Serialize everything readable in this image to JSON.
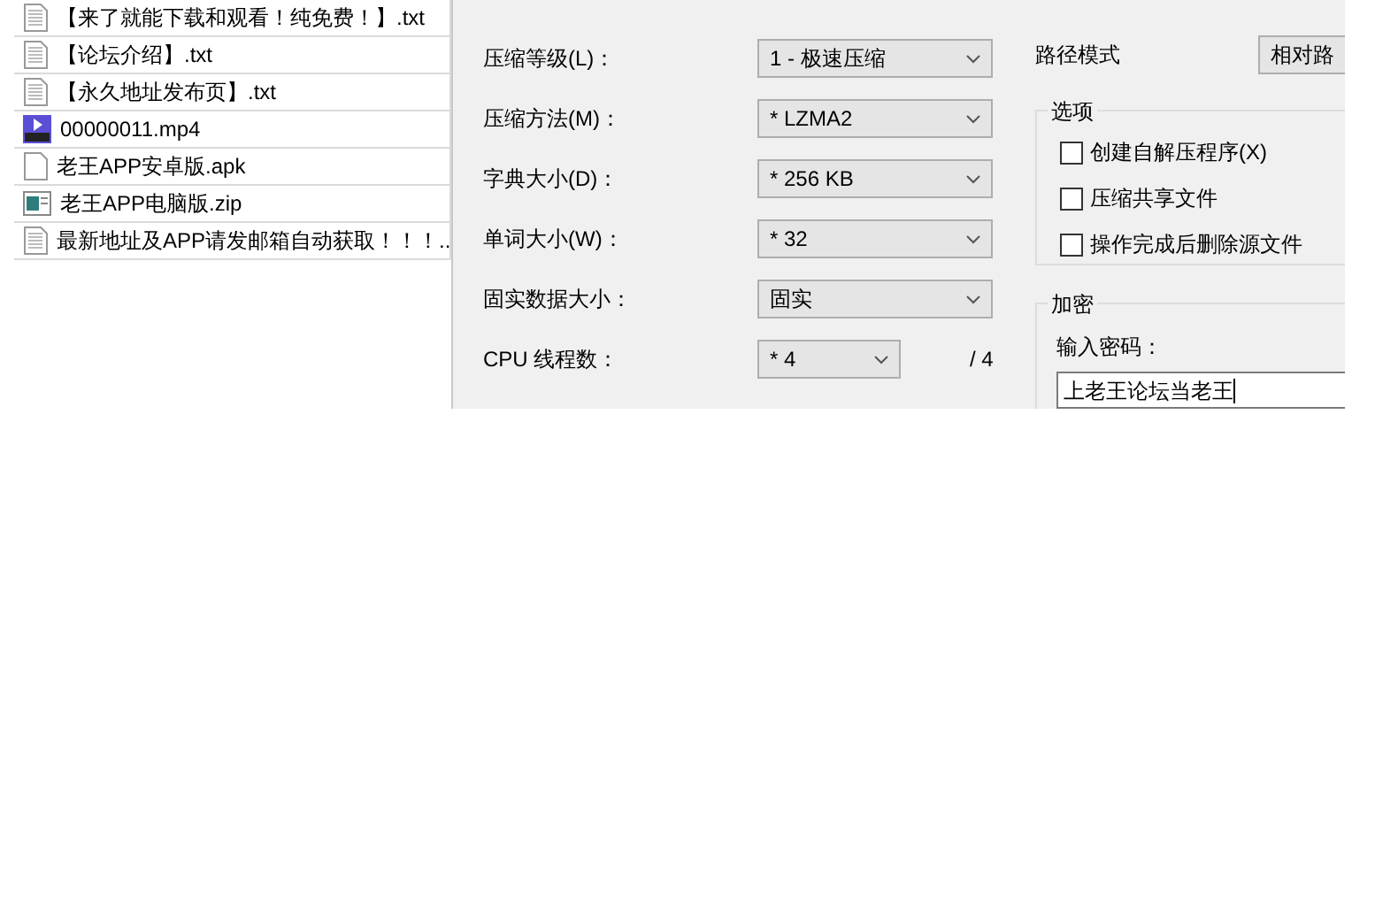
{
  "file_list": [
    {
      "name": "【来了就能下载和观看！纯免费！】.txt",
      "kind": "text"
    },
    {
      "name": "【论坛介绍】.txt",
      "kind": "text"
    },
    {
      "name": "【永久地址发布页】.txt",
      "kind": "text"
    },
    {
      "name": "00000011.mp4",
      "kind": "video"
    },
    {
      "name": "老王APP安卓版.apk",
      "kind": "blank"
    },
    {
      "name": "老王APP电脑版.zip",
      "kind": "archive"
    },
    {
      "name": "最新地址及APP请发邮箱自动获取！！！..",
      "kind": "text"
    }
  ],
  "settings": [
    {
      "label": "压缩等级(L)：",
      "value": "1 - 极速压缩"
    },
    {
      "label": "压缩方法(M)：",
      "value": "* LZMA2"
    },
    {
      "label": "字典大小(D)：",
      "value": "* 256 KB"
    },
    {
      "label": "单词大小(W)：",
      "value": "* 32"
    },
    {
      "label": "固实数据大小：",
      "value": "固实"
    }
  ],
  "cpu_threads": {
    "label": "CPU 线程数：",
    "value": "* 4",
    "max": "/ 4"
  },
  "path_mode": {
    "label": "路径模式",
    "value": "相对路"
  },
  "options": {
    "title": "选项",
    "items": [
      {
        "label": "创建自解压程序(X)",
        "checked": false
      },
      {
        "label": "压缩共享文件",
        "checked": false
      },
      {
        "label": "操作完成后删除源文件",
        "checked": false
      }
    ]
  },
  "encryption": {
    "title": "加密",
    "password_label": "输入密码：",
    "password": "上老王论坛当老王"
  }
}
